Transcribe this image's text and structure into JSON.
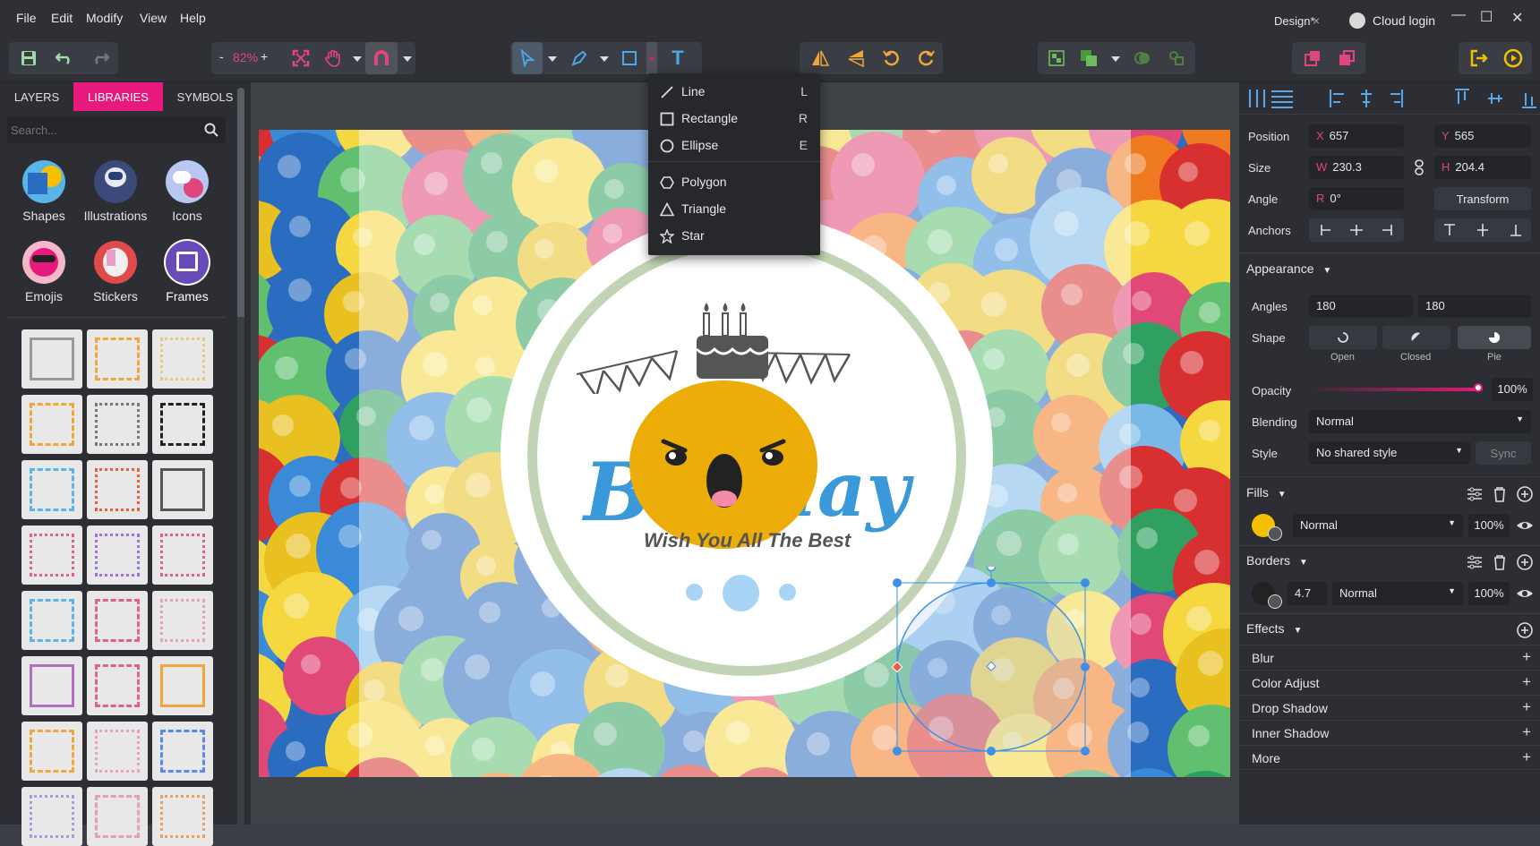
{
  "menubar": {
    "items": [
      "File",
      "Edit",
      "Modify",
      "View",
      "Help"
    ],
    "tab_label": "Design*",
    "tab_close": "×",
    "cloud_login": "Cloud login",
    "minimize": "—",
    "maximize": "☐",
    "close": "✕"
  },
  "toolbar": {
    "zoom_minus": "-",
    "zoom_value": "82%",
    "zoom_plus": "+",
    "text_tool": "T"
  },
  "shape_menu": {
    "items": [
      {
        "label": "Line",
        "key": "L",
        "icon": "line-icon"
      },
      {
        "label": "Rectangle",
        "key": "R",
        "icon": "rectangle-icon"
      },
      {
        "label": "Ellipse",
        "key": "E",
        "icon": "ellipse-icon"
      },
      {
        "label": "Polygon",
        "key": "",
        "icon": "polygon-icon"
      },
      {
        "label": "Triangle",
        "key": "",
        "icon": "triangle-icon"
      },
      {
        "label": "Star",
        "key": "",
        "icon": "star-icon"
      }
    ]
  },
  "left_panel": {
    "tabs": [
      "LAYERS",
      "LIBRARIES",
      "SYMBOLS"
    ],
    "active_tab": "LIBRARIES",
    "search_placeholder": "Search...",
    "libraries": [
      "Shapes",
      "Illustrations",
      "Icons",
      "Emojis",
      "Stickers",
      "Frames"
    ],
    "active_library": "Frames"
  },
  "canvas": {
    "text_birthday_left": "B",
    "text_birthday_right": "lay",
    "subtitle": "Wish You All The Best"
  },
  "right_panel": {
    "position_label": "Position",
    "x_prefix": "X",
    "x_value": "657",
    "y_prefix": "Y",
    "y_value": "565",
    "size_label": "Size",
    "w_prefix": "W",
    "w_value": "230.3",
    "h_prefix": "H",
    "h_value": "204.4",
    "angle_label": "Angle",
    "r_prefix": "R",
    "angle_value": "0°",
    "transform_button": "Transform",
    "anchors_label": "Anchors",
    "appearance_label": "Appearance",
    "angles_label": "Angles",
    "angle_start": "180",
    "angle_end": "180",
    "shape_label": "Shape",
    "shape_options": [
      "Open",
      "Closed",
      "Pie"
    ],
    "active_shape": "Pie",
    "opacity_label": "Opacity",
    "opacity_value": "100%",
    "opacity_fraction": 1.0,
    "blending_label": "Blending",
    "blending_value": "Normal",
    "style_label": "Style",
    "style_value": "No shared style",
    "sync_button": "Sync",
    "fills_label": "Fills",
    "fill_color": "#f5c000",
    "fill_blend": "Normal",
    "fill_opacity": "100%",
    "borders_label": "Borders",
    "border_width": "4.7",
    "border_blend": "Normal",
    "border_opacity": "100%",
    "effects_label": "Effects",
    "effects": [
      "Blur",
      "Color Adjust",
      "Drop Shadow",
      "Inner Shadow",
      "More"
    ]
  },
  "colors": {
    "accent": "#e8197d",
    "selection": "#3d8fe8",
    "text_blue": "#3a9ad9"
  }
}
